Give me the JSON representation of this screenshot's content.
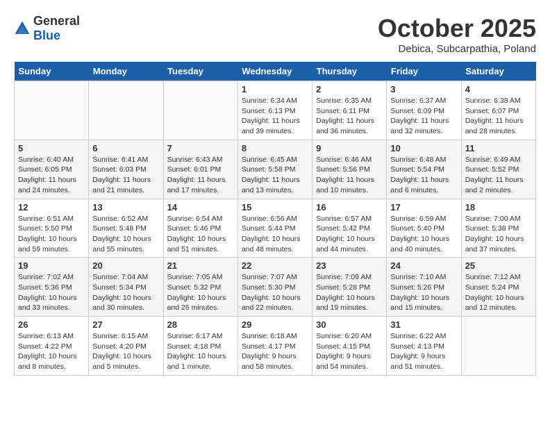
{
  "logo": {
    "general": "General",
    "blue": "Blue"
  },
  "header": {
    "month": "October 2025",
    "location": "Debica, Subcarpathia, Poland"
  },
  "days_of_week": [
    "Sunday",
    "Monday",
    "Tuesday",
    "Wednesday",
    "Thursday",
    "Friday",
    "Saturday"
  ],
  "weeks": [
    [
      {
        "num": "",
        "info": ""
      },
      {
        "num": "",
        "info": ""
      },
      {
        "num": "",
        "info": ""
      },
      {
        "num": "1",
        "info": "Sunrise: 6:34 AM\nSunset: 6:13 PM\nDaylight: 11 hours\nand 39 minutes."
      },
      {
        "num": "2",
        "info": "Sunrise: 6:35 AM\nSunset: 6:11 PM\nDaylight: 11 hours\nand 36 minutes."
      },
      {
        "num": "3",
        "info": "Sunrise: 6:37 AM\nSunset: 6:09 PM\nDaylight: 11 hours\nand 32 minutes."
      },
      {
        "num": "4",
        "info": "Sunrise: 6:38 AM\nSunset: 6:07 PM\nDaylight: 11 hours\nand 28 minutes."
      }
    ],
    [
      {
        "num": "5",
        "info": "Sunrise: 6:40 AM\nSunset: 6:05 PM\nDaylight: 11 hours\nand 24 minutes."
      },
      {
        "num": "6",
        "info": "Sunrise: 6:41 AM\nSunset: 6:03 PM\nDaylight: 11 hours\nand 21 minutes."
      },
      {
        "num": "7",
        "info": "Sunrise: 6:43 AM\nSunset: 6:01 PM\nDaylight: 11 hours\nand 17 minutes."
      },
      {
        "num": "8",
        "info": "Sunrise: 6:45 AM\nSunset: 5:58 PM\nDaylight: 11 hours\nand 13 minutes."
      },
      {
        "num": "9",
        "info": "Sunrise: 6:46 AM\nSunset: 5:56 PM\nDaylight: 11 hours\nand 10 minutes."
      },
      {
        "num": "10",
        "info": "Sunrise: 6:48 AM\nSunset: 5:54 PM\nDaylight: 11 hours\nand 6 minutes."
      },
      {
        "num": "11",
        "info": "Sunrise: 6:49 AM\nSunset: 5:52 PM\nDaylight: 11 hours\nand 2 minutes."
      }
    ],
    [
      {
        "num": "12",
        "info": "Sunrise: 6:51 AM\nSunset: 5:50 PM\nDaylight: 10 hours\nand 59 minutes."
      },
      {
        "num": "13",
        "info": "Sunrise: 6:52 AM\nSunset: 5:48 PM\nDaylight: 10 hours\nand 55 minutes."
      },
      {
        "num": "14",
        "info": "Sunrise: 6:54 AM\nSunset: 5:46 PM\nDaylight: 10 hours\nand 51 minutes."
      },
      {
        "num": "15",
        "info": "Sunrise: 6:56 AM\nSunset: 5:44 PM\nDaylight: 10 hours\nand 48 minutes."
      },
      {
        "num": "16",
        "info": "Sunrise: 6:57 AM\nSunset: 5:42 PM\nDaylight: 10 hours\nand 44 minutes."
      },
      {
        "num": "17",
        "info": "Sunrise: 6:59 AM\nSunset: 5:40 PM\nDaylight: 10 hours\nand 40 minutes."
      },
      {
        "num": "18",
        "info": "Sunrise: 7:00 AM\nSunset: 5:38 PM\nDaylight: 10 hours\nand 37 minutes."
      }
    ],
    [
      {
        "num": "19",
        "info": "Sunrise: 7:02 AM\nSunset: 5:36 PM\nDaylight: 10 hours\nand 33 minutes."
      },
      {
        "num": "20",
        "info": "Sunrise: 7:04 AM\nSunset: 5:34 PM\nDaylight: 10 hours\nand 30 minutes."
      },
      {
        "num": "21",
        "info": "Sunrise: 7:05 AM\nSunset: 5:32 PM\nDaylight: 10 hours\nand 26 minutes."
      },
      {
        "num": "22",
        "info": "Sunrise: 7:07 AM\nSunset: 5:30 PM\nDaylight: 10 hours\nand 22 minutes."
      },
      {
        "num": "23",
        "info": "Sunrise: 7:09 AM\nSunset: 5:28 PM\nDaylight: 10 hours\nand 19 minutes."
      },
      {
        "num": "24",
        "info": "Sunrise: 7:10 AM\nSunset: 5:26 PM\nDaylight: 10 hours\nand 15 minutes."
      },
      {
        "num": "25",
        "info": "Sunrise: 7:12 AM\nSunset: 5:24 PM\nDaylight: 10 hours\nand 12 minutes."
      }
    ],
    [
      {
        "num": "26",
        "info": "Sunrise: 6:13 AM\nSunset: 4:22 PM\nDaylight: 10 hours\nand 8 minutes."
      },
      {
        "num": "27",
        "info": "Sunrise: 6:15 AM\nSunset: 4:20 PM\nDaylight: 10 hours\nand 5 minutes."
      },
      {
        "num": "28",
        "info": "Sunrise: 6:17 AM\nSunset: 4:18 PM\nDaylight: 10 hours\nand 1 minute."
      },
      {
        "num": "29",
        "info": "Sunrise: 6:18 AM\nSunset: 4:17 PM\nDaylight: 9 hours\nand 58 minutes."
      },
      {
        "num": "30",
        "info": "Sunrise: 6:20 AM\nSunset: 4:15 PM\nDaylight: 9 hours\nand 54 minutes."
      },
      {
        "num": "31",
        "info": "Sunrise: 6:22 AM\nSunset: 4:13 PM\nDaylight: 9 hours\nand 51 minutes."
      },
      {
        "num": "",
        "info": ""
      }
    ]
  ]
}
